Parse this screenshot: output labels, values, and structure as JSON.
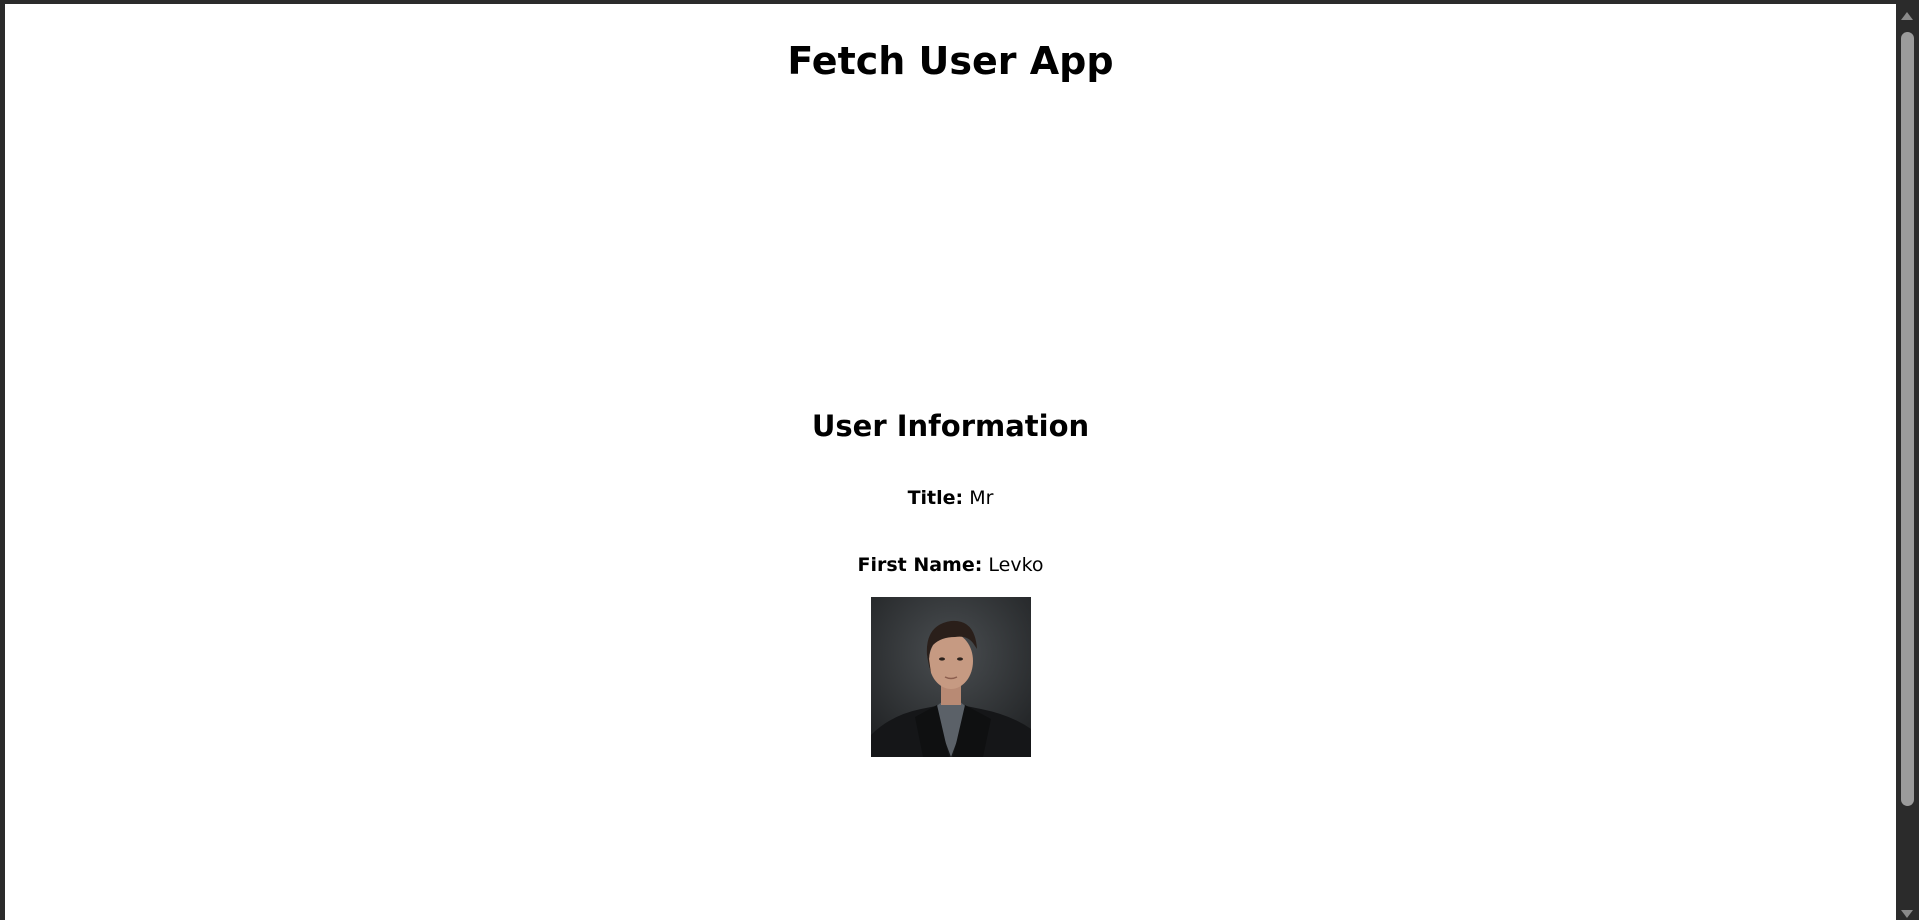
{
  "app": {
    "title": "Fetch User App"
  },
  "user_info": {
    "heading": "User Information",
    "title_label": "Title:",
    "title_value": "Mr",
    "first_name_label": "First Name:",
    "first_name_value": "Levko",
    "photo_alt": "User photo"
  },
  "colors": {
    "background": "#ffffff",
    "window_frame": "#2b2b2b",
    "text": "#000000"
  }
}
